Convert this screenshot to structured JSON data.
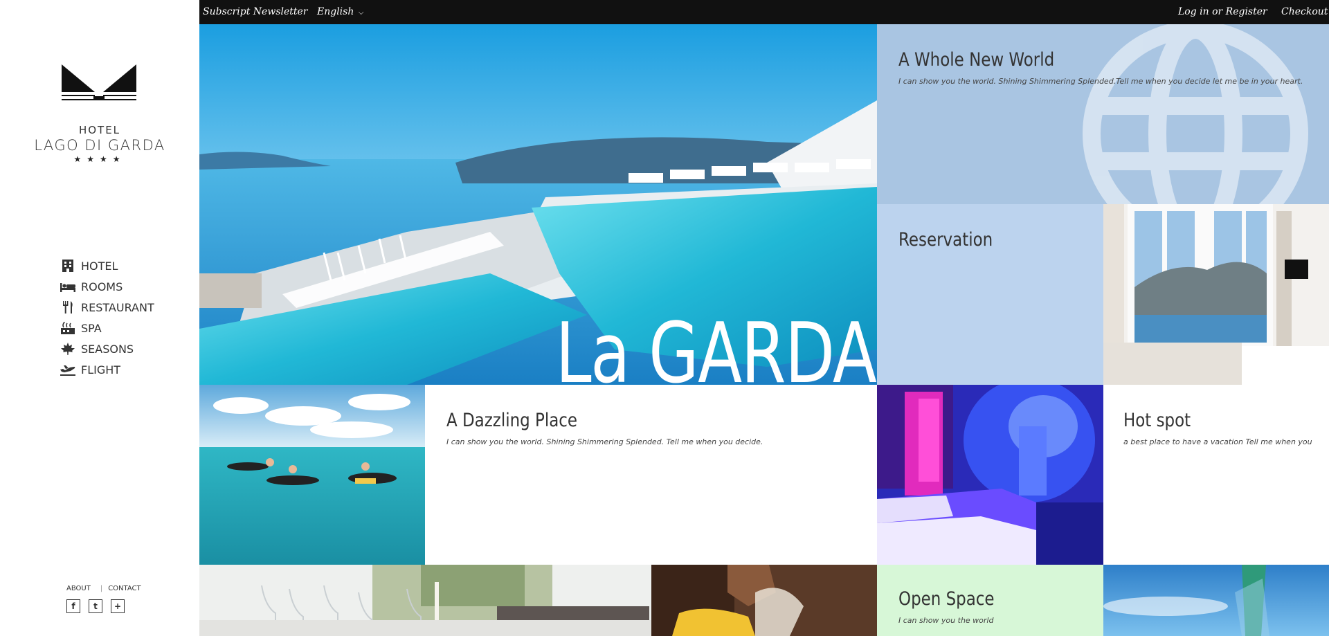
{
  "topbar": {
    "newsletter": "Subscript Newsletter",
    "language": "English",
    "login": "Log in or Register",
    "checkout": "Checkout"
  },
  "brand": {
    "line1": "HOTEL",
    "line2": "LAGO DI GARDA",
    "stars": "★★★★"
  },
  "nav": {
    "items": [
      {
        "label": "HOTEL",
        "icon": "building-icon"
      },
      {
        "label": "ROOMS",
        "icon": "bed-icon"
      },
      {
        "label": "RESTAURANT",
        "icon": "fork-knife-icon"
      },
      {
        "label": "SPA",
        "icon": "spa-icon"
      },
      {
        "label": "SEASONS",
        "icon": "maple-leaf-icon"
      },
      {
        "label": "FLIGHT",
        "icon": "plane-icon"
      }
    ]
  },
  "footer": {
    "about": "ABOUT",
    "contact": "CONTACT",
    "social": [
      {
        "glyph": "f",
        "icon": "facebook-icon"
      },
      {
        "glyph": "t",
        "icon": "twitter-icon"
      },
      {
        "glyph": "+",
        "icon": "plus-icon"
      }
    ]
  },
  "tiles": {
    "hero": {
      "title": "La GARDA"
    },
    "world": {
      "title": "A Whole New World",
      "subtitle": "I can show you the world. Shining Shimmering Splended.Tell me when you decide let me be in your heart."
    },
    "reservation": {
      "title": "Reservation"
    },
    "dazzling": {
      "title": "A Dazzling Place",
      "subtitle": "I can show you the world. Shining Shimmering Splended. Tell me when you decide."
    },
    "hotspot": {
      "title": "Hot spot",
      "subtitle": "a best place to have a vacation Tell me when you"
    },
    "openspace": {
      "title": "Open Space",
      "subtitle": "I can show you the world"
    }
  },
  "colors": {
    "topbar": "#111111",
    "world_bg": "#a9c5e2",
    "reservation_bg": "#bcd3ee",
    "openspace_bg": "#d7f7d7",
    "pool": "#2cc3da"
  }
}
